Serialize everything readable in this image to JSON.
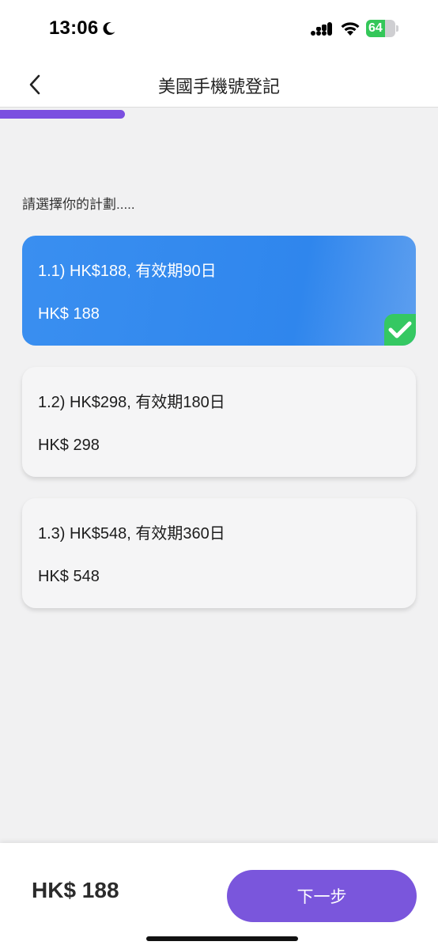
{
  "status_bar": {
    "time": "13:06",
    "battery_level": "64",
    "battery_fraction": 0.64,
    "icons": [
      "moon-icon",
      "signal-icon",
      "wifi-icon",
      "battery-icon"
    ]
  },
  "header": {
    "back_icon": "chevron-left-icon",
    "title": "美國手機號登記"
  },
  "progress": {
    "fraction": 0.285,
    "color": "#7b4fe0"
  },
  "prompt": "請選擇你的計劃.....",
  "plans": [
    {
      "title": "1.1) HK$188, 有效期90日",
      "price": "HK$ 188",
      "selected": true
    },
    {
      "title": "1.2) HK$298, 有效期180日",
      "price": "HK$ 298",
      "selected": false
    },
    {
      "title": "1.3) HK$548, 有效期360日",
      "price": "HK$ 548",
      "selected": false
    }
  ],
  "footer": {
    "total": "HK$ 188",
    "next_label": "下一步"
  },
  "colors": {
    "accent": "#7a56dc",
    "selected_card": "#3a8ff0",
    "check_badge": "#35c862",
    "background": "#f1f1f2"
  }
}
